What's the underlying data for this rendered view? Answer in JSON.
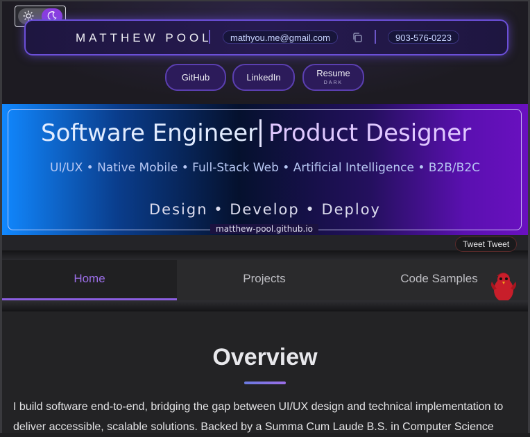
{
  "header": {
    "name": "MATTHEW POOL",
    "email": "mathyou.me@gmail.com",
    "phone": "903-576-0223",
    "links": [
      {
        "label": "GitHub"
      },
      {
        "label": "LinkedIn"
      },
      {
        "label": "Resume",
        "sub": "DARK"
      }
    ]
  },
  "theme": {
    "mode": "dark",
    "icons": [
      "sun-icon",
      "moon-icon"
    ]
  },
  "banner": {
    "title_left": "Software Engineer",
    "title_right": "Product Designer",
    "skills": "UI/UX • Native Mobile • Full-Stack Web • Artificial Intelligence • B2B/B2C",
    "tagline": "Design • Develop • Deploy",
    "url": "matthew-pool.github.io"
  },
  "tweet": "Tweet Tweet",
  "nav": {
    "tabs": [
      {
        "label": "Home",
        "active": true
      },
      {
        "label": "Projects",
        "active": false
      },
      {
        "label": "Code Samples",
        "active": false
      }
    ]
  },
  "main": {
    "heading": "Overview",
    "paragraph": "I build software end-to-end, bridging the gap between UI/UX design and technical implementation to deliver accessible, scalable solutions. Backed by a Summa Cum Laude B.S. in Computer Science"
  },
  "colors": {
    "accent": "#8b5ee0",
    "contact_border": "#6b4fd8"
  }
}
